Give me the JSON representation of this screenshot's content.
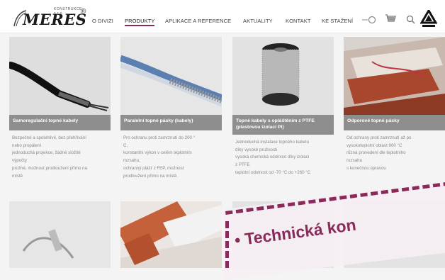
{
  "header": {
    "logo": {
      "text": "MERES",
      "subtext": "KONSTRUKCE s.r.o.",
      "reg": "®"
    },
    "nav": [
      {
        "label": "O DIVIZI"
      },
      {
        "label": "PRODUKTY"
      },
      {
        "label": "APLIKACE A REFERENCE"
      },
      {
        "label": "AKTUALITY"
      },
      {
        "label": "KONTAKT"
      },
      {
        "label": "KE STAŽENÍ"
      }
    ],
    "icons": [
      "login-toggle-icon",
      "cart-icon",
      "search-icon",
      "raychem-logo"
    ],
    "accent_color": "#8a2a5a"
  },
  "products": [
    {
      "title": "Samoregulační topné kabely",
      "desc": [
        "Bezpečné a spolehlivé, bez přehřívání",
        "nebo propálení",
        "jednoduchá projekce, žádné složité",
        "výpočty",
        "pružné, možnost prodloužení přímo na",
        "místě"
      ]
    },
    {
      "title": "Paralelní topné pásky (kabely)",
      "desc": [
        "Pro ochranu proti zamrznutí do 200 °",
        "C,",
        "konstantní výkon v celém teplotním",
        "rozsahu,",
        "ochranný plášť z FEP, možnost",
        "prodloužení přímo na místě."
      ]
    },
    {
      "title": "Topné kabely s opláštěním z PTFE (plastovou izolací PI)",
      "desc": [
        "Jednoduchá instalace topného kabelu",
        "díky vysoké pružnosti",
        "vysoká chemická odolnost díky izolaci",
        "z PTFE",
        "teplotní odolnost od -70 °C do +260 °C"
      ]
    },
    {
      "title": "Odporové topné pásky",
      "desc": [
        "Od ochrany proti zamrznutí až po",
        "vysokoteplotní oblast 900 °C",
        "různá provedení dle teplotního",
        "rozsahu",
        "s konečnou úpravou"
      ]
    }
  ],
  "banner": {
    "text": "• Technická kon"
  }
}
